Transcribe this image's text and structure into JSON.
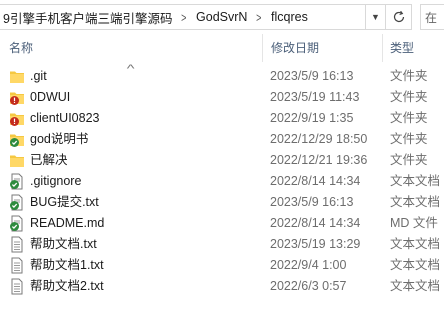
{
  "address": {
    "crumbs": [
      "9引擎手机客户端三端引擎源码",
      "GodSvrN",
      "flcqres"
    ],
    "search_placeholder": "在"
  },
  "columns": {
    "name": "名称",
    "date": "修改日期",
    "type": "类型"
  },
  "files": [
    {
      "name": ".git",
      "date": "2023/5/9 16:13",
      "type": "文件夹",
      "icon": "folder-icon"
    },
    {
      "name": "0DWUI",
      "date": "2023/5/19 11:43",
      "type": "文件夹",
      "icon": "folder-conflict-icon"
    },
    {
      "name": "clientUI0823",
      "date": "2022/9/19 1:35",
      "type": "文件夹",
      "icon": "folder-conflict-icon"
    },
    {
      "name": "god说明书",
      "date": "2022/12/29 18:50",
      "type": "文件夹",
      "icon": "folder-synced-icon"
    },
    {
      "name": "已解决",
      "date": "2022/12/21 19:36",
      "type": "文件夹",
      "icon": "folder-icon"
    },
    {
      "name": ".gitignore",
      "date": "2022/8/14 14:34",
      "type": "文本文档",
      "icon": "file-synced-icon"
    },
    {
      "name": "BUG提交.txt",
      "date": "2023/5/9 16:13",
      "type": "文本文档",
      "icon": "file-synced-icon"
    },
    {
      "name": "README.md",
      "date": "2022/8/14 14:34",
      "type": "MD 文件",
      "icon": "file-synced-icon"
    },
    {
      "name": "帮助文档.txt",
      "date": "2023/5/19 13:29",
      "type": "文本文档",
      "icon": "text-file-icon"
    },
    {
      "name": "帮助文档1.txt",
      "date": "2022/9/4 1:00",
      "type": "文本文档",
      "icon": "text-file-icon"
    },
    {
      "name": "帮助文档2.txt",
      "date": "2022/6/3 0:57",
      "type": "文本文档",
      "icon": "text-file-icon"
    }
  ],
  "colors": {
    "folder": "#f5c842",
    "conflict_badge": "#c42b1c",
    "synced_badge": "#2e8b3e",
    "header_text": "#4c607a"
  }
}
